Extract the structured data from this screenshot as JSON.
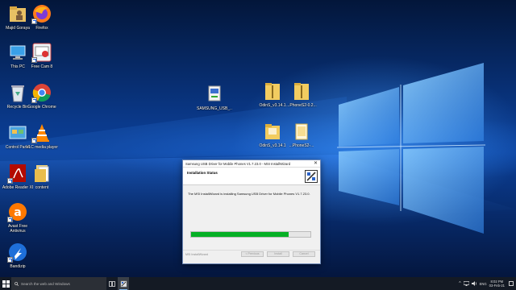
{
  "desktop": {
    "icons": [
      {
        "label": "Majid Goraya",
        "icon": "user-folder-icon"
      },
      {
        "label": "Firefox",
        "icon": "firefox-icon"
      },
      {
        "label": "This PC",
        "icon": "this-pc-icon"
      },
      {
        "label": "Free Cam 8",
        "icon": "free-cam-icon"
      },
      {
        "label": "Recycle Bin",
        "icon": "recycle-bin-icon"
      },
      {
        "label": "Google Chrome",
        "icon": "chrome-icon"
      },
      {
        "label": "Control Panel",
        "icon": "control-panel-icon"
      },
      {
        "label": "VLC media player",
        "icon": "vlc-icon"
      },
      {
        "label": "Adobe Reader XI",
        "icon": "adobe-reader-icon"
      },
      {
        "label": "content",
        "icon": "folder-icon"
      },
      {
        "label": "Avast Free Antivirus",
        "icon": "avast-icon"
      },
      {
        "label": "Bandizip",
        "icon": "bandizip-icon"
      },
      {
        "label": "SAMSUNG_USB_...",
        "icon": "installer-file-icon"
      },
      {
        "label": "OdinS_v3.14.1",
        "icon": "zip-folder-icon"
      },
      {
        "label": "...PhoneS2-0.2...",
        "icon": "zip-folder-icon"
      },
      {
        "label": "OdinS_v3.14.1",
        "icon": "folder-icon"
      },
      {
        "label": "...PhoneS2-...",
        "icon": "file-icon"
      }
    ]
  },
  "installer": {
    "title": "Samsung USB Driver for Mobile Phones V1.7.23.0 - MSI InstallWizard",
    "close_glyph": "✕",
    "heading": "Installation Status",
    "status_message": "The MSI InstallWizard is installing Samsung USB Driver for Mobile Phones V1.7.23.0.",
    "progress": 0.82,
    "footer_brand": "MSI InstallWizard",
    "buttons": {
      "previous": "< Previous",
      "install": "Install",
      "cancel": "Cancel"
    }
  },
  "taskbar": {
    "search_placeholder": "Search the web and Windows",
    "language": "ENG",
    "time": "8:02 PM",
    "date": "03-Feb-21"
  },
  "colors": {
    "accent": "#0a3a8c",
    "progress": "#06b025",
    "taskbar": "#141a24"
  }
}
